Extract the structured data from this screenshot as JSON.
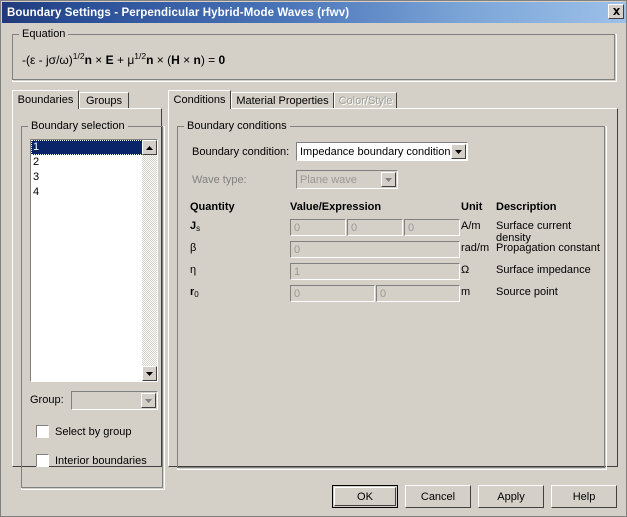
{
  "window": {
    "title": "Boundary Settings - Perpendicular Hybrid-Mode Waves (rfwv)",
    "close_icon": "close-icon"
  },
  "equation": {
    "legend": "Equation",
    "parts": {
      "p1": "-(ε - jσ/ω)",
      "sup1": "1/2",
      "n1": "n",
      "times1": " × ",
      "E": "E",
      "plus": " + ",
      "mu": "μ",
      "sup2": "1/2",
      "n2": "n",
      "times2": " × (",
      "H": "H",
      "times3": " × ",
      "n3": "n",
      "eq": ") = ",
      "zero": "0"
    }
  },
  "left_tabs": [
    {
      "label": "Boundaries",
      "active": true
    },
    {
      "label": "Groups",
      "active": false
    }
  ],
  "right_tabs": [
    {
      "label": "Conditions",
      "active": true,
      "disabled": false
    },
    {
      "label": "Material Properties",
      "active": false,
      "disabled": false
    },
    {
      "label": "Color/Style",
      "active": false,
      "disabled": true
    }
  ],
  "boundary_selection": {
    "legend": "Boundary selection",
    "items": [
      "1",
      "2",
      "3",
      "4"
    ],
    "selected_index": 0,
    "scroll_up_icon": "triangle-up-icon",
    "scroll_down_icon": "triangle-down-icon",
    "group_label": "Group:",
    "group_value": "",
    "group_arrow_icon": "chevron-down-icon",
    "checkboxes": [
      {
        "label": "Select by group",
        "checked": false
      },
      {
        "label": "Interior boundaries",
        "checked": false
      }
    ]
  },
  "boundary_conditions": {
    "legend": "Boundary conditions",
    "condition_label": "Boundary condition:",
    "condition_value": "Impedance boundary condition",
    "condition_arrow_icon": "chevron-down-icon",
    "wave_type_label": "Wave type:",
    "wave_type_value": "Plane wave",
    "wave_type_arrow_icon": "chevron-down-icon",
    "headers": {
      "quantity": "Quantity",
      "value": "Value/Expression",
      "unit": "Unit",
      "description": "Description"
    },
    "rows": [
      {
        "symbol": "J",
        "sub": "s",
        "bold": true,
        "values": [
          "0",
          "0",
          "0"
        ],
        "unit": "A/m",
        "description": "Surface current density"
      },
      {
        "symbol": "β",
        "sub": "",
        "bold": false,
        "values": [
          "0"
        ],
        "unit": "rad/m",
        "description": "Propagation constant"
      },
      {
        "symbol": "η",
        "sub": "",
        "bold": false,
        "values": [
          "1"
        ],
        "unit": "Ω",
        "description": "Surface impedance"
      },
      {
        "symbol": "r",
        "sub": "0",
        "bold": true,
        "values": [
          "0",
          "0"
        ],
        "unit": "m",
        "description": "Source point"
      }
    ]
  },
  "buttons": [
    {
      "label": "OK",
      "default": true
    },
    {
      "label": "Cancel",
      "default": false
    },
    {
      "label": "Apply",
      "default": false
    },
    {
      "label": "Help",
      "default": false
    }
  ],
  "colors": {
    "face": "#d4d0c8",
    "title_left": "#1f3a7a",
    "title_right": "#9cc0e8",
    "selection": "#0a246a",
    "disabled_text": "#9a9a94"
  }
}
